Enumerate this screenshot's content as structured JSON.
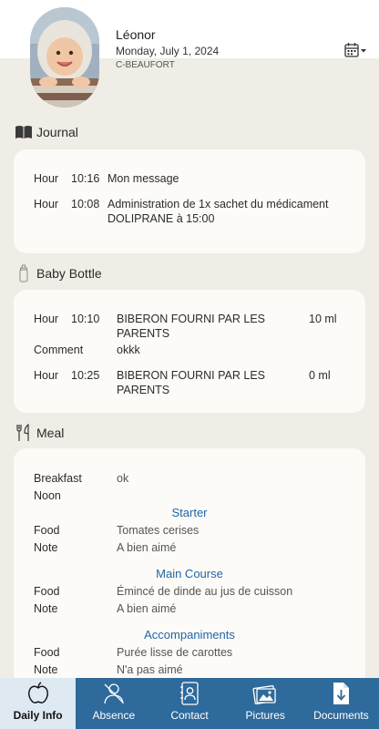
{
  "header": {
    "child_name": "Léonor",
    "date": "Monday, July 1, 2024",
    "place": "C-BEAUFORT",
    "calendar_icon": "calendar-icon"
  },
  "journal": {
    "title": "Journal",
    "icon": "book-icon",
    "entries": [
      {
        "label": "Hour",
        "time": "10:16",
        "text": "Mon message"
      },
      {
        "label": "Hour",
        "time": "10:08",
        "text": "Administration de 1x sachet du médicament DOLIPRANE à 15:00"
      }
    ]
  },
  "bottle": {
    "title": "Baby Bottle",
    "icon": "baby-bottle-icon",
    "entries": [
      {
        "label": "Hour",
        "time": "10:10",
        "text": "BIBERON FOURNI PAR LES PARENTS",
        "qty": "10 ml"
      },
      {
        "label": "Comment",
        "text": "okkk"
      },
      {
        "label": "Hour",
        "time": "10:25",
        "text": "BIBERON FOURNI PAR LES PARENTS",
        "qty": "0 ml"
      }
    ]
  },
  "meal": {
    "title": "Meal",
    "icon": "fork-knife-icon",
    "breakfast_label": "Breakfast",
    "breakfast_value": "ok",
    "noon_label": "Noon",
    "courses": [
      {
        "name": "Starter",
        "food_label": "Food",
        "food": "Tomates cerises",
        "note_label": "Note",
        "note": "A bien aimé"
      },
      {
        "name": "Main Course",
        "food_label": "Food",
        "food": "Émincé de dinde au jus de cuisson",
        "note_label": "Note",
        "note": "A bien aimé"
      },
      {
        "name": "Accompaniments",
        "food_label": "Food",
        "food": "Purée lisse de carottes",
        "note_label": "Note",
        "note": "N'a pas aimé"
      }
    ]
  },
  "nav": {
    "items": [
      {
        "label": "Daily Info",
        "icon": "apple-icon",
        "active": true
      },
      {
        "label": "Absence",
        "icon": "absence-icon",
        "active": false
      },
      {
        "label": "Contact",
        "icon": "contact-icon",
        "active": false
      },
      {
        "label": "Pictures",
        "icon": "pictures-icon",
        "active": false
      },
      {
        "label": "Documents",
        "icon": "documents-icon",
        "active": false
      }
    ]
  },
  "colors": {
    "background": "#f0ede6",
    "card": "#fcfbf7",
    "nav": "#2e6a9c",
    "nav_active": "#dfe9f2",
    "course_heading": "#2265a8"
  }
}
